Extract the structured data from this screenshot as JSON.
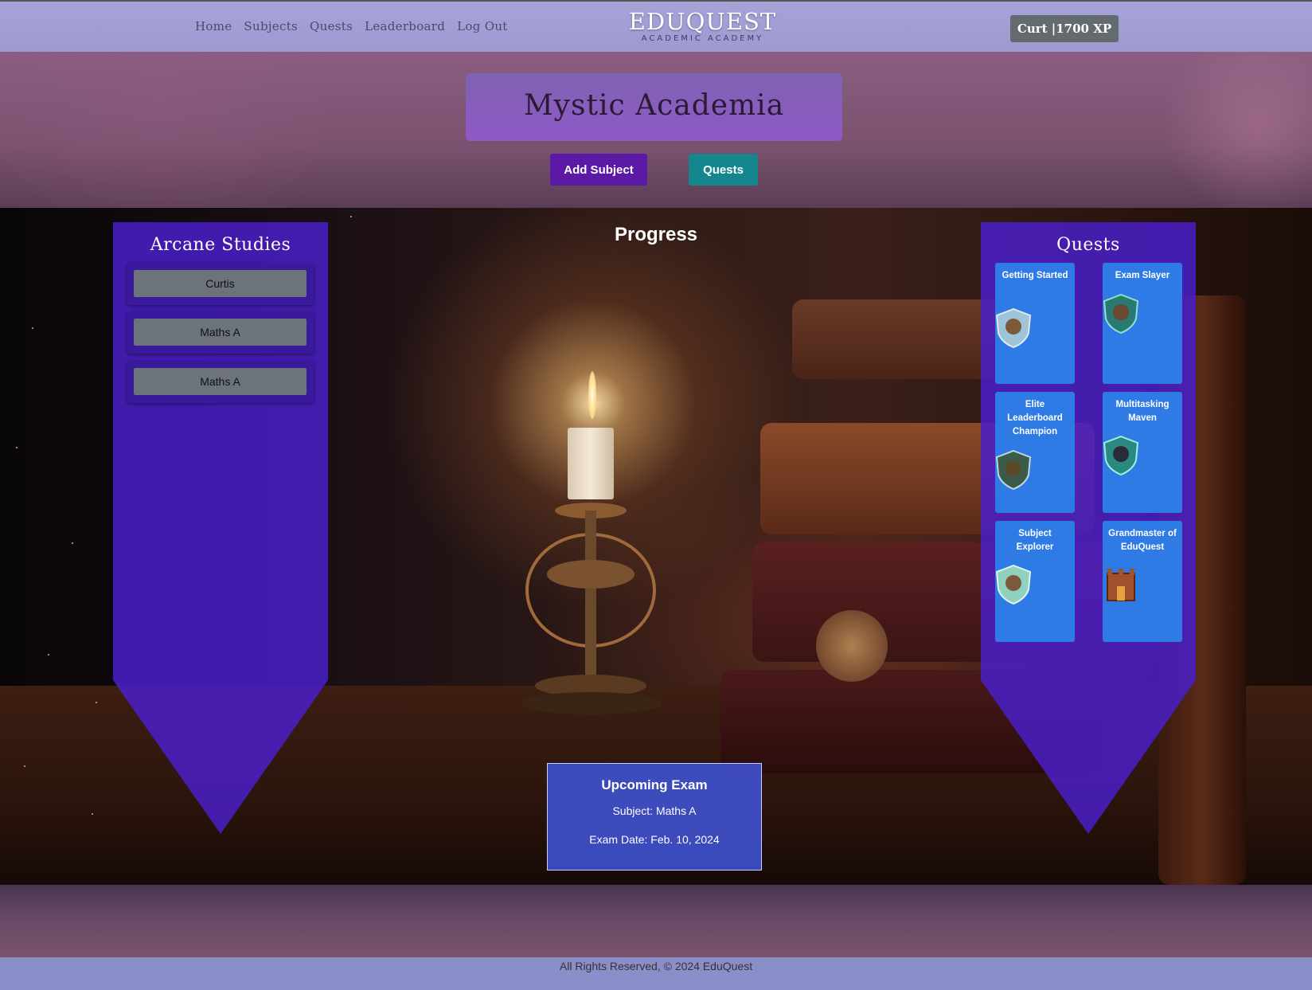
{
  "nav": {
    "links": [
      "Home",
      "Subjects",
      "Quests",
      "Leaderboard",
      "Log Out"
    ],
    "brand_title": "EDUQUEST",
    "brand_sub": "ACADEMIC ACADEMY",
    "user_label": "Curt |1700 XP"
  },
  "header": {
    "title": "Mystic Academia",
    "add_subject_label": "Add Subject",
    "quests_label": "Quests"
  },
  "main": {
    "progress_title": "Progress",
    "left_banner": {
      "title": "Arcane Studies",
      "subjects": [
        "Curtis",
        "Maths A",
        "Maths A"
      ]
    },
    "right_banner": {
      "title": "Quests",
      "quests": [
        {
          "name": "Getting Started"
        },
        {
          "name": "Exam Slayer"
        },
        {
          "name": "Elite Leaderboard Champion"
        },
        {
          "name": "Multitasking Maven"
        },
        {
          "name": "Subject Explorer"
        },
        {
          "name": "Grandmaster of EduQuest"
        }
      ]
    },
    "exam": {
      "title": "Upcoming Exam",
      "subject": "Subject: Maths A",
      "date": "Exam Date: Feb. 10, 2024"
    }
  },
  "footer": {
    "text": "All Rights Reserved, © 2024 EduQuest"
  },
  "colors": {
    "navbar": "#a6a3d8",
    "title_box": "#8a5dbf",
    "add_button": "#5b19a6",
    "quests_button": "#15868d",
    "banner": "#4a1fc9",
    "quest_card": "#2f7be6",
    "exam_box": "#4155dc",
    "footer": "#8a8fca"
  }
}
